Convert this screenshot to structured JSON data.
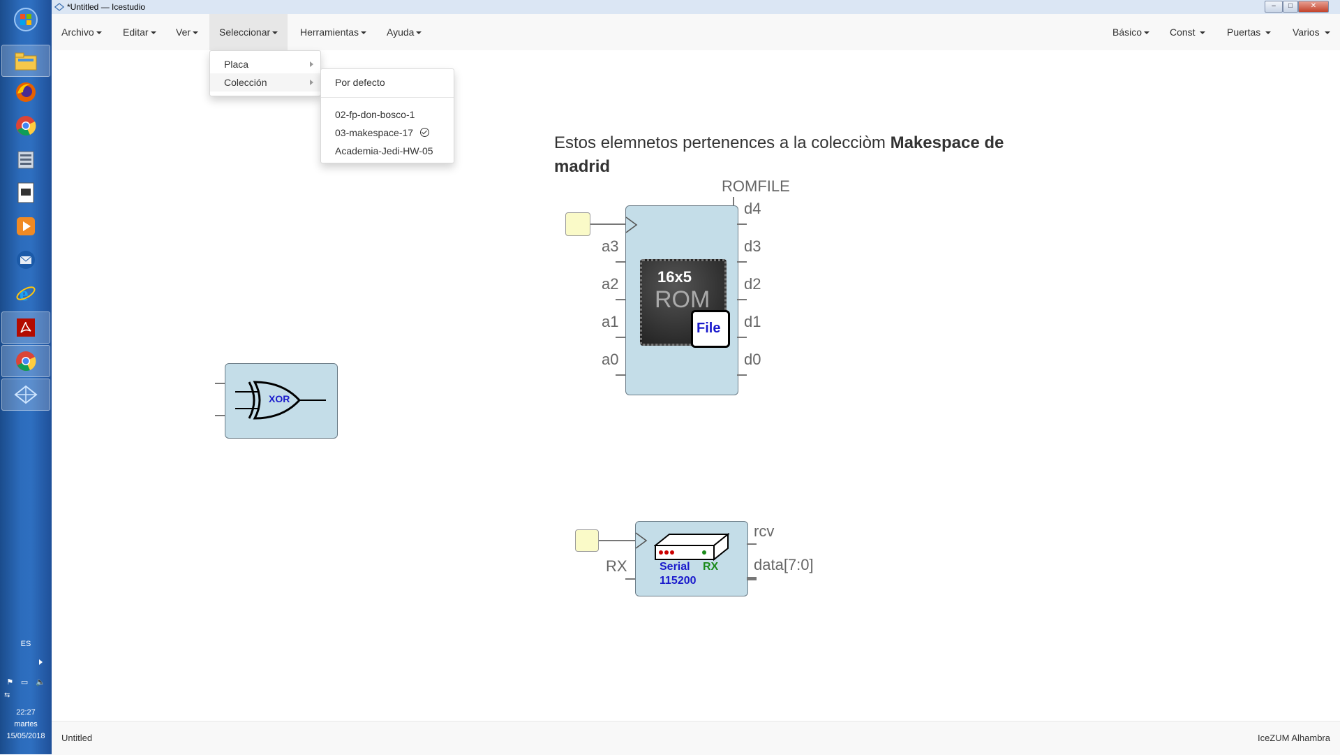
{
  "window": {
    "title": "*Untitled — Icestudio",
    "controls": {
      "minimize": "–",
      "maximize": "□",
      "close": "✕"
    }
  },
  "taskbar": {
    "language": "ES",
    "clock": {
      "time": "22:27",
      "day": "martes",
      "date": "15/05/2018"
    },
    "icons": [
      "windows-start-icon",
      "file-explorer-icon",
      "firefox-icon",
      "chrome-icon",
      "file-manager-icon",
      "document-icon",
      "media-player-icon",
      "thunderbird-icon",
      "internet-explorer-icon",
      "acrobat-icon",
      "chrome-icon",
      "icestudio-icon"
    ]
  },
  "menubar": {
    "left": [
      "Archivo",
      "Editar",
      "Ver",
      "Seleccionar",
      "Herramientas",
      "Ayuda"
    ],
    "right": [
      "Básico",
      "Const",
      "Puertas",
      "Varios"
    ]
  },
  "seleccionar_menu": {
    "items": [
      "Placa",
      "Colección"
    ]
  },
  "coleccion_submenu": {
    "default": "Por defecto",
    "items": [
      "02-fp-don-bosco-1",
      "03-makespace-17",
      "Academia-Jedi-HW-05"
    ],
    "selected": "03-makespace-17"
  },
  "canvas": {
    "info": {
      "prefix": "Estos elemnetos pertenences a la colecciòm ",
      "bold_line1": "Makespace de",
      "bold_line2": "madrid"
    },
    "xor_block": {
      "label": "XOR"
    },
    "rom_block": {
      "param": "ROMFILE",
      "inputs": [
        "a3",
        "a2",
        "a1",
        "a0"
      ],
      "outputs": [
        "d4",
        "d3",
        "d2",
        "d1",
        "d0"
      ],
      "chip_size": "16x5",
      "chip_label": "ROM",
      "file_label": "File"
    },
    "serial_block": {
      "input": "RX",
      "outputs": [
        "rcv",
        "data[7:0]"
      ],
      "label_serial": "Serial",
      "label_rx": "RX",
      "label_baud": "115200"
    }
  },
  "footer": {
    "left": "Untitled",
    "right": "IceZUM Alhambra"
  }
}
